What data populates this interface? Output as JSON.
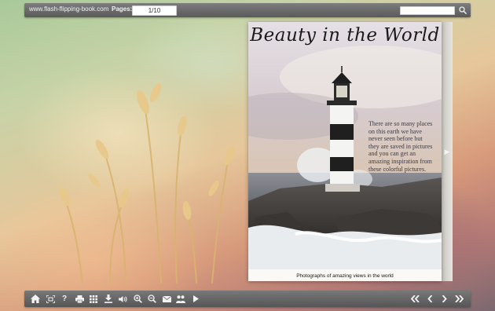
{
  "toolbar_top": {
    "site": "www.flash-flipping-book.com",
    "pages_label": "Pages:",
    "page_value": "1/10",
    "search_value": ""
  },
  "book": {
    "title": "Beauty in the World",
    "text": "There are so many places on this earth we have never seen before but they are saved in pictures and you can get an amazing inspiration from these colorful pictures.",
    "caption": "Photographs of amazing views in the world"
  },
  "toolbar_bottom": {
    "buttons": [
      "home-icon",
      "fit-screen-icon",
      "help-icon",
      "print-icon",
      "thumbnails-icon",
      "download-icon",
      "sound-icon",
      "zoom-in-icon",
      "zoom-out-icon",
      "email-icon",
      "share-icon",
      "autoplay-icon",
      "first-page-icon",
      "previous-page-icon",
      "next-page-icon",
      "last-page-icon"
    ]
  },
  "colors": {
    "toolbar": "#666666",
    "page": "#faf9f5",
    "title": "#1a1a1a"
  }
}
